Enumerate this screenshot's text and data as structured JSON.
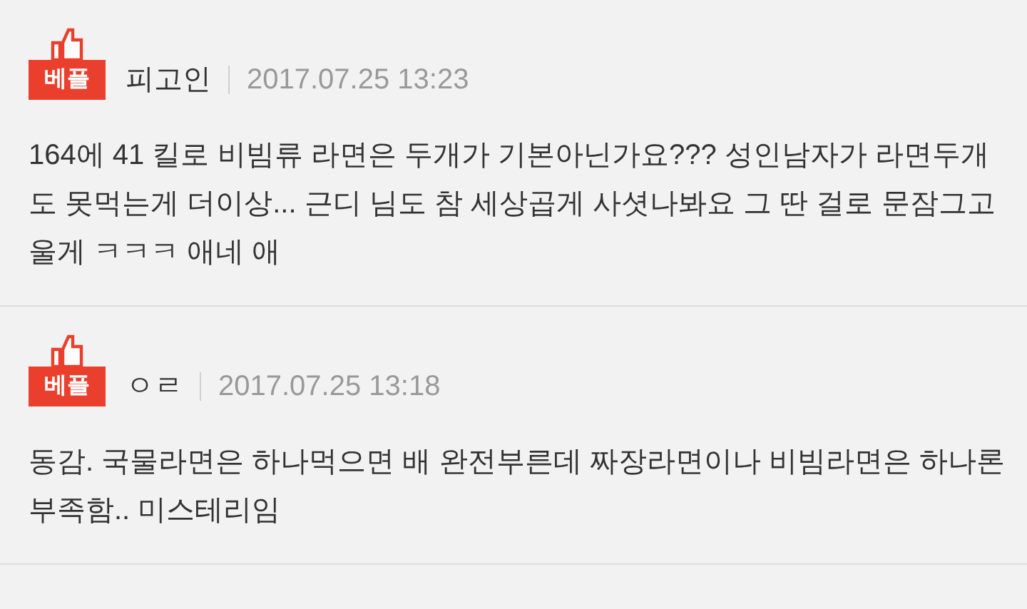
{
  "comments": [
    {
      "best": true,
      "badge": "베플",
      "author": "피고인",
      "date": "2017.07.25 13:23",
      "text": "164에 41 킬로 비빔류 라면은 두개가 기본아닌가요??? 성인남자가 라면두개도 못먹는게 더이상... 근디 님도 참 세상곱게 사셧나봐요 그 딴 걸로 문잠그고 울게 ㅋㅋㅋ 애네 애"
    },
    {
      "best": true,
      "badge": "베플",
      "author": "ㅇㄹ",
      "date": "2017.07.25 13:18",
      "text": "동감. 국물라면은 하나먹으면 배 완전부른데 짜장라면이나 비빔라면은 하나론 부족함.. 미스테리임"
    }
  ]
}
